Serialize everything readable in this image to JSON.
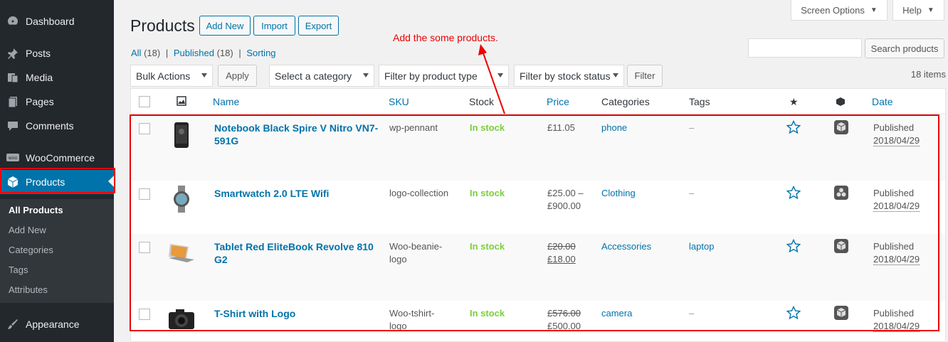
{
  "sidebar": {
    "items": [
      {
        "label": "Dashboard",
        "icon": "dashboard-icon"
      },
      {
        "label": "Posts",
        "icon": "pin-icon"
      },
      {
        "label": "Media",
        "icon": "media-icon"
      },
      {
        "label": "Pages",
        "icon": "pages-icon"
      },
      {
        "label": "Comments",
        "icon": "comment-icon"
      },
      {
        "label": "WooCommerce",
        "icon": "woocommerce-icon"
      },
      {
        "label": "Products",
        "icon": "box-icon"
      },
      {
        "label": "Appearance",
        "icon": "paintbrush-icon"
      }
    ],
    "submenu": [
      "All Products",
      "Add New",
      "Categories",
      "Tags",
      "Attributes"
    ]
  },
  "header": {
    "title": "Products",
    "add_new": "Add New",
    "import": "Import",
    "export": "Export",
    "screen_options": "Screen Options",
    "help": "Help"
  },
  "views": {
    "all": "All",
    "all_count": "(18)",
    "published": "Published",
    "published_count": "(18)",
    "sorting": "Sorting",
    "sep": "|"
  },
  "search": {
    "button": "Search products"
  },
  "filters": {
    "bulk_actions": "Bulk Actions",
    "apply": "Apply",
    "category": "Select a category",
    "product_type": "Filter by product type",
    "stock_status": "Filter by stock status",
    "filter": "Filter",
    "items_count": "18 items"
  },
  "annotation": "Add the some products.",
  "columns": {
    "name": "Name",
    "sku": "SKU",
    "stock": "Stock",
    "price": "Price",
    "categories": "Categories",
    "tags": "Tags",
    "date": "Date"
  },
  "rows": [
    {
      "name_l1": "Notebook Black Spire V Nitro VN7-",
      "name_l2": "591G",
      "sku_l1": "wp-pennant",
      "sku_l2": "",
      "stock": "In stock",
      "price_l1": "£11.05",
      "price_l2": "",
      "category": "phone",
      "tags": "–",
      "status": "Published",
      "date": "2018/04/29",
      "type_icon": "simple-box-icon"
    },
    {
      "name_l1": "Smartwatch 2.0 LTE Wifi",
      "name_l2": "",
      "sku_l1": "logo-collection",
      "sku_l2": "",
      "stock": "In stock",
      "price_l1": "£25.00 –",
      "price_l2": "£900.00",
      "category": "Clothing",
      "tags": "–",
      "status": "Published",
      "date": "2018/04/29",
      "type_icon": "grouped-icon"
    },
    {
      "name_l1": "Tablet Red EliteBook Revolve 810",
      "name_l2": "G2",
      "sku_l1": "Woo-beanie-",
      "sku_l2": "logo",
      "stock": "In stock",
      "price_l1": "£20.00",
      "price_l2": "£18.00",
      "category": "Accessories",
      "tags": "laptop",
      "status": "Published",
      "date": "2018/04/29",
      "type_icon": "simple-box-icon"
    },
    {
      "name_l1": "T-Shirt with Logo",
      "name_l2": "",
      "sku_l1": "Woo-tshirt-",
      "sku_l2": "logo",
      "stock": "In stock",
      "price_l1": "£576.00",
      "price_l2": "£500.00",
      "category": "camera",
      "tags": "–",
      "status": "Published",
      "date": "2018/04/29",
      "type_icon": "simple-box-icon"
    }
  ],
  "colors": {
    "accent": "#0073aa",
    "in_stock": "#7ad03a",
    "annotation": "#ee0000",
    "sidebar": "#23282d"
  }
}
